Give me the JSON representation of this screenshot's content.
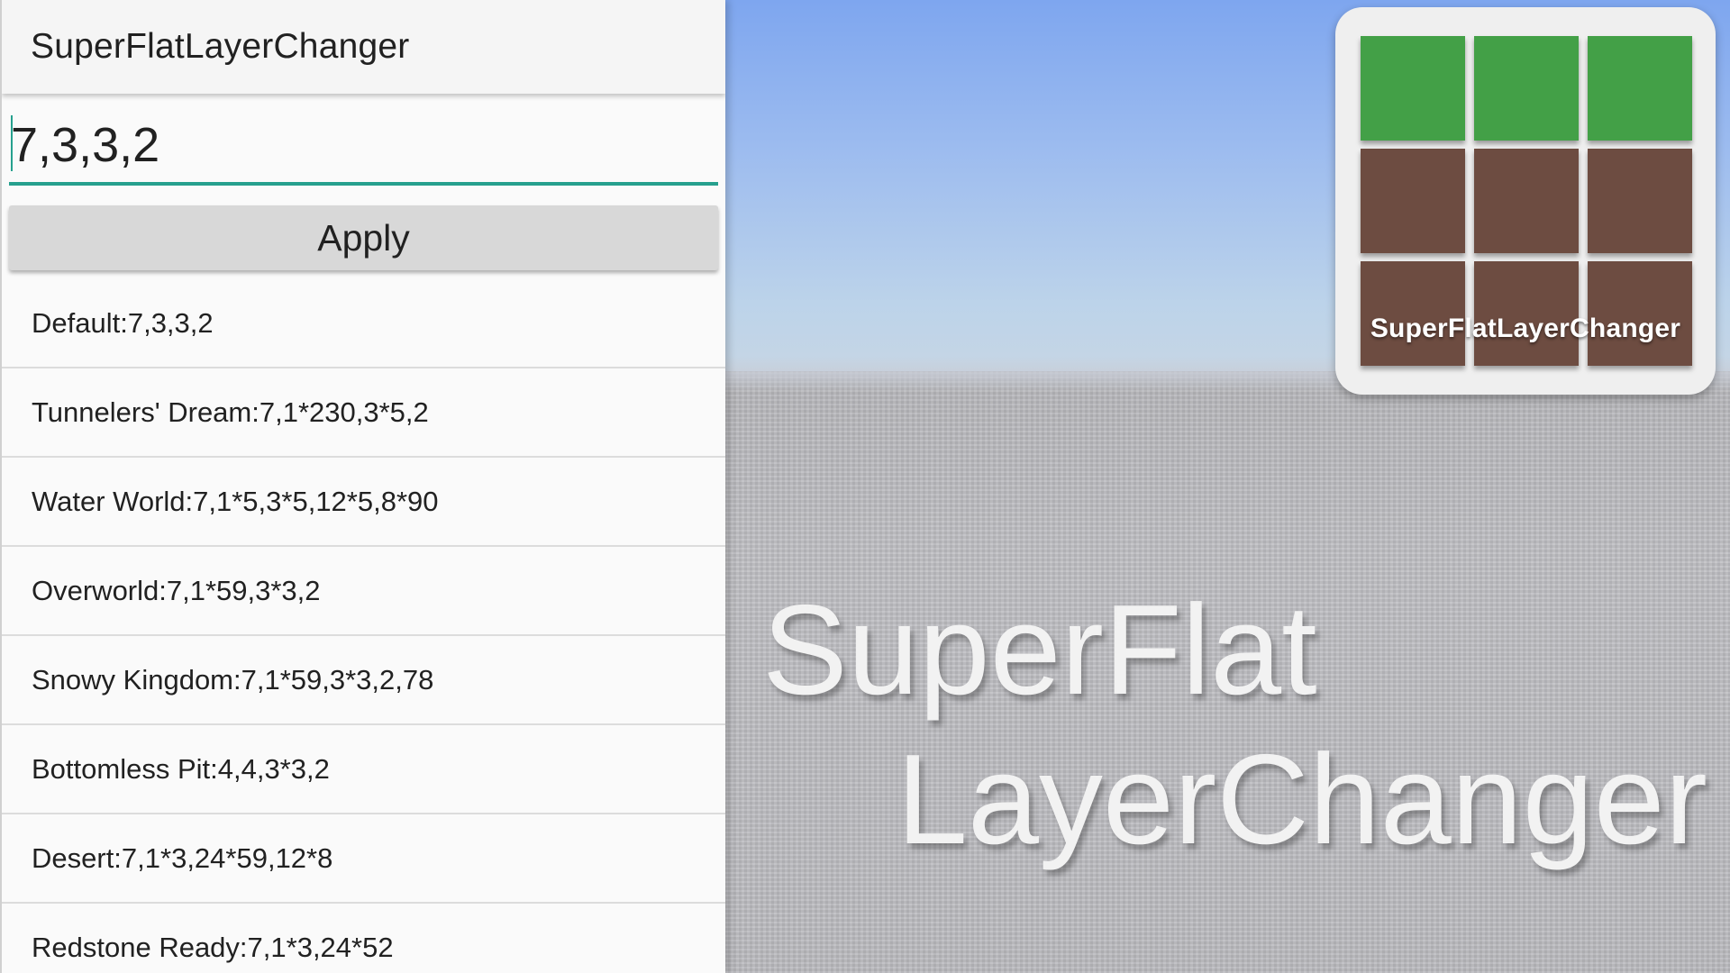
{
  "app": {
    "title": "SuperFlatLayerChanger"
  },
  "layer_input": {
    "value": "7,3,3,2"
  },
  "apply_button": {
    "label": "Apply"
  },
  "presets": [
    {
      "label": "Default:7,3,3,2"
    },
    {
      "label": "Tunnelers' Dream:7,1*230,3*5,2"
    },
    {
      "label": "Water World:7,1*5,3*5,12*5,8*90"
    },
    {
      "label": "Overworld:7,1*59,3*3,2"
    },
    {
      "label": "Snowy Kingdom:7,1*59,3*3,2,78"
    },
    {
      "label": "Bottomless Pit:4,4,3*3,2"
    },
    {
      "label": "Desert:7,1*3,24*59,12*8"
    },
    {
      "label": "Redstone Ready:7,1*3,24*52"
    }
  ],
  "banner": {
    "icon_label": "SuperFlatLayerChanger",
    "line1": "SuperFlat",
    "line2": "LayerChanger"
  },
  "colors": {
    "accent": "#26a08e",
    "grass": "#43a047",
    "dirt": "#6d4c41",
    "sky": "#7ea6ef"
  },
  "icons": {
    "app_icon": "grass-dirt-grid-icon"
  }
}
